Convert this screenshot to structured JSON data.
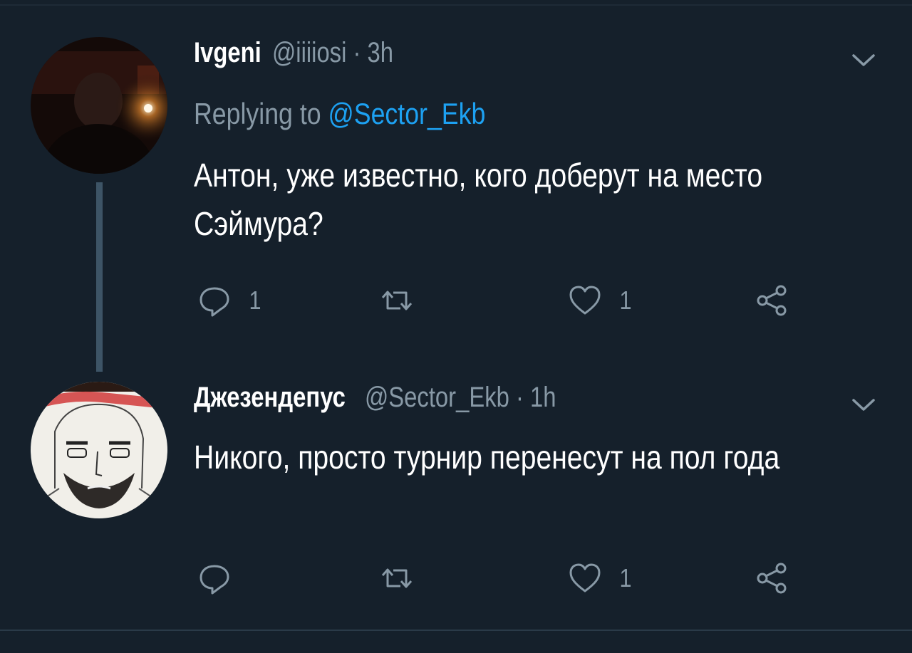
{
  "tweets": [
    {
      "name": "Ivgeni",
      "handle": "@iiiiosi",
      "time": "3h",
      "replying_prefix": "Replying to ",
      "replying_to": "@Sector_Ekb",
      "text": "Антон, уже известно, кого доберут на место Сэймура?",
      "reply_count": "1",
      "retweet_count": "",
      "like_count": "1"
    },
    {
      "name": "Джезендепус",
      "handle": "@Sector_Ekb",
      "time": "1h",
      "text": "Никого, просто турнир перенесут на пол года",
      "reply_count": "",
      "retweet_count": "",
      "like_count": "1"
    }
  ],
  "separator": "·",
  "icons": {
    "reply": "reply-icon",
    "retweet": "retweet-icon",
    "like": "heart-icon",
    "share": "share-icon",
    "more": "chevron-down-icon"
  },
  "colors": {
    "background": "#15202b",
    "secondary_text": "#8899a6",
    "mention": "#1da1f2",
    "thread_line": "#3d5466"
  }
}
